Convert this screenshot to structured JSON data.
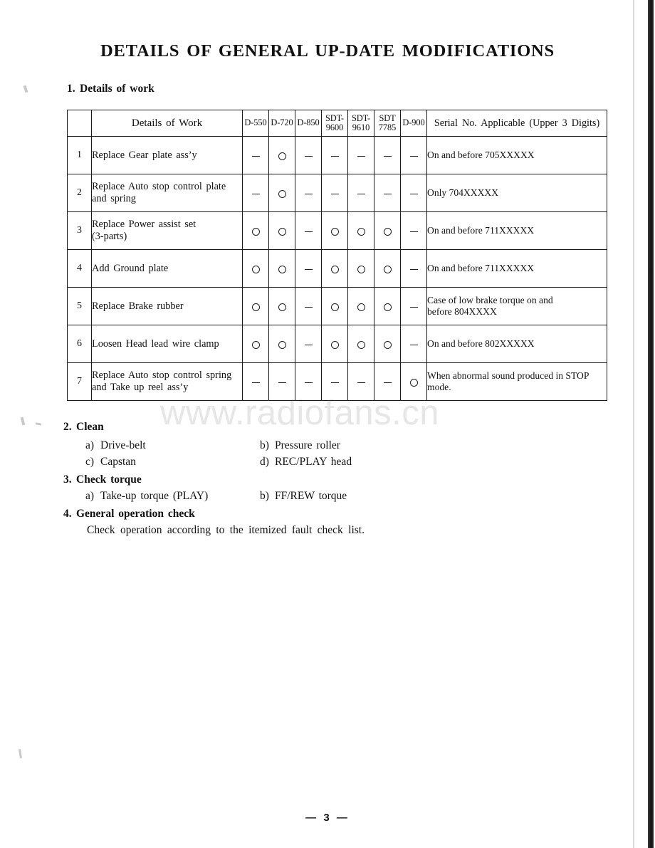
{
  "document": {
    "title": "DETAILS OF GENERAL UP-DATE MODIFICATIONS",
    "watermark": "www.radiofans.cn",
    "page_footer": "—  3  —"
  },
  "section_1": {
    "number": "1.",
    "heading": "Details of work",
    "table": {
      "headers": {
        "row_no": "",
        "details_of_work": "Details of Work",
        "models": [
          {
            "line1": "D-550",
            "line2": ""
          },
          {
            "line1": "D-720",
            "line2": ""
          },
          {
            "line1": "D-850",
            "line2": ""
          },
          {
            "line1": "SDT-",
            "line2": "9600"
          },
          {
            "line1": "SDT-",
            "line2": "9610"
          },
          {
            "line1": "SDT",
            "line2": "7785"
          },
          {
            "line1": "D-900",
            "line2": ""
          }
        ],
        "serial_no": "Serial No.  Applicable  (Upper  3  Digits)"
      },
      "rows": [
        {
          "no": "1",
          "work_line1": "Replace  Gear  plate  ass’y",
          "work_line2": "",
          "marks": [
            "dash",
            "circle",
            "dash",
            "dash",
            "dash",
            "dash",
            "dash"
          ],
          "serial_line1": "On and before 705XXXXX",
          "serial_line2": ""
        },
        {
          "no": "2",
          "work_line1": "Replace  Auto  stop  control  plate",
          "work_line2": "and spring",
          "marks": [
            "dash",
            "circle",
            "dash",
            "dash",
            "dash",
            "dash",
            "dash"
          ],
          "serial_line1": "Only 704XXXXX",
          "serial_line2": ""
        },
        {
          "no": "3",
          "work_line1": "Replace  Power  assist  set",
          "work_line2": "(3-parts)",
          "marks": [
            "circle",
            "circle",
            "dash",
            "circle",
            "circle",
            "circle",
            "dash"
          ],
          "serial_line1": "On and before 711XXXXX",
          "serial_line2": ""
        },
        {
          "no": "4",
          "work_line1": "Add  Ground  plate",
          "work_line2": "",
          "marks": [
            "circle",
            "circle",
            "dash",
            "circle",
            "circle",
            "circle",
            "dash"
          ],
          "serial_line1": "On and before 711XXXXX",
          "serial_line2": ""
        },
        {
          "no": "5",
          "work_line1": "Replace  Brake  rubber",
          "work_line2": "",
          "marks": [
            "circle",
            "circle",
            "dash",
            "circle",
            "circle",
            "circle",
            "dash"
          ],
          "serial_line1": "Case of low brake torque on and",
          "serial_line2": "before 804XXXX"
        },
        {
          "no": "6",
          "work_line1": "Loosen  Head  lead  wire  clamp",
          "work_line2": "",
          "marks": [
            "circle",
            "circle",
            "dash",
            "circle",
            "circle",
            "circle",
            "dash"
          ],
          "serial_line1": "On and before 802XXXXX",
          "serial_line2": ""
        },
        {
          "no": "7",
          "work_line1": "Replace  Auto  stop  control  spring",
          "work_line2": "and Take up reel ass’y",
          "marks": [
            "dash",
            "dash",
            "dash",
            "dash",
            "dash",
            "dash",
            "circle"
          ],
          "serial_line1": "When abnormal sound produced in STOP",
          "serial_line2": "mode."
        }
      ]
    }
  },
  "section_2": {
    "number": "2.",
    "heading": "Clean",
    "items": [
      {
        "letter": "a)",
        "text": "Drive-belt"
      },
      {
        "letter": "b)",
        "text": "Pressure roller"
      },
      {
        "letter": "c)",
        "text": "Capstan"
      },
      {
        "letter": "d)",
        "text": "REC/PLAY  head"
      }
    ]
  },
  "section_3": {
    "number": "3.",
    "heading": "Check  torque",
    "items": [
      {
        "letter": "a)",
        "text": "Take-up  torque  (PLAY)"
      },
      {
        "letter": "b)",
        "text": "FF/REW  torque"
      }
    ]
  },
  "section_4": {
    "number": "4.",
    "heading": "General  operation  check",
    "body": "Check  operation  according  to  the  itemized  fault  check  list."
  }
}
